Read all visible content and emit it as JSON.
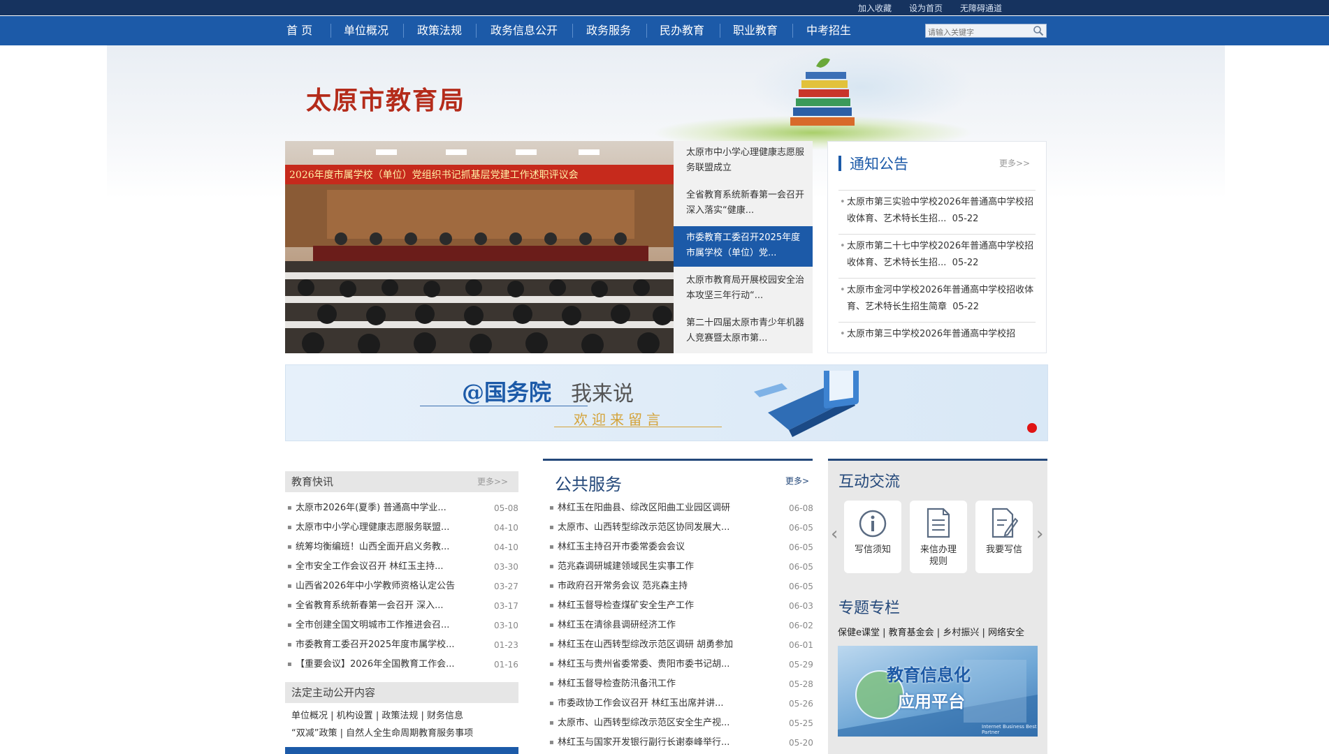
{
  "topbar": {
    "links": [
      "加入收藏",
      "设为首页",
      "无障碍通道"
    ]
  },
  "nav": {
    "items": [
      "首 页",
      "单位概况",
      "政策法规",
      "政务信息公开",
      "政务服务",
      "民办教育",
      "职业教育",
      "中考招生"
    ],
    "search_placeholder": "请输入关键字"
  },
  "banner": {
    "site_title": "太原市教育局"
  },
  "slider": {
    "photo_caption": "2026年度市属学校（单位）党组织书记抓基层党建工作述职评议会",
    "tabs": [
      "太原市中小学心理健康志愿服务联盟成立",
      "全省教育系统新春第一会召开 深入落实“健康...",
      "市委教育工委召开2025年度市属学校（单位）党...",
      "太原市教育局开展校园安全治本攻坚三年行动“...",
      "第二十四届太原市青少年机器人竞赛暨太原市第..."
    ],
    "active_index": 2
  },
  "notice": {
    "title": "通知公告",
    "more": "更多>>",
    "items": [
      {
        "text": "太原市第三实验中学校2026年普通高中学校招收体育、艺术特长生招...",
        "date": "05-22"
      },
      {
        "text": "太原市第二十七中学校2026年普通高中学校招收体育、艺术特长生招...",
        "date": "05-22"
      },
      {
        "text": "太原市金河中学校2026年普通高中学校招收体育、艺术特长生招生简章",
        "date": "05-22"
      },
      {
        "text": "太原市第三中学校2026年普通高中学校招",
        "date": ""
      }
    ]
  },
  "promo": {
    "line1a": "@国务院",
    "line1b": "我来说",
    "line2": "欢迎来留言"
  },
  "edu_news": {
    "title": "教育快讯",
    "more": "更多>>",
    "items": [
      {
        "text": "太原市2026年(夏季) 普通高中学业...",
        "date": "05-08"
      },
      {
        "text": "太原市中小学心理健康志愿服务联盟...",
        "date": "04-10"
      },
      {
        "text": "统筹均衡编班！山西全面开启义务教...",
        "date": "04-10"
      },
      {
        "text": "全市安全工作会议召开 林红玉主持...",
        "date": "03-30"
      },
      {
        "text": "山西省2026年中小学教师资格认定公告",
        "date": "03-27"
      },
      {
        "text": "全省教育系统新春第一会召开 深入...",
        "date": "03-17"
      },
      {
        "text": "全市创建全国文明城市工作推进会召...",
        "date": "03-10"
      },
      {
        "text": "市委教育工委召开2025年度市属学校...",
        "date": "01-23"
      },
      {
        "text": "【重要会议】2026年全国教育工作会...",
        "date": "01-16"
      }
    ]
  },
  "legal": {
    "title": "法定主动公开内容",
    "row1": [
      "单位概况",
      "机构设置",
      "政策法规",
      "财务信息"
    ],
    "row2": [
      "“双减”政策",
      "自然人全生命周期教育服务事项"
    ]
  },
  "public_service": {
    "title": "公共服务",
    "more": "更多>",
    "items": [
      {
        "text": "林红玉在阳曲县、综改区阳曲工业园区调研",
        "date": "06-08"
      },
      {
        "text": "太原市、山西转型综改示范区协同发展大...",
        "date": "06-05"
      },
      {
        "text": "林红玉主持召开市委常委会会议",
        "date": "06-05"
      },
      {
        "text": "范兆森调研城建领域民生实事工作",
        "date": "06-05"
      },
      {
        "text": "市政府召开常务会议 范兆森主持",
        "date": "06-05"
      },
      {
        "text": "林红玉督导检查煤矿安全生产工作",
        "date": "06-03"
      },
      {
        "text": "林红玉在清徐县调研经济工作",
        "date": "06-02"
      },
      {
        "text": "林红玉在山西转型综改示范区调研 胡勇参加",
        "date": "06-01"
      },
      {
        "text": "林红玉与贵州省委常委、贵阳市委书记胡...",
        "date": "05-29"
      },
      {
        "text": "林红玉督导检查防汛备汛工作",
        "date": "05-28"
      },
      {
        "text": "市委政协工作会议召开 林红玉出席并讲...",
        "date": "05-26"
      },
      {
        "text": "太原市、山西转型综改示范区安全生产视...",
        "date": "05-25"
      },
      {
        "text": "林红玉与国家开发银行副行长谢泰峰举行...",
        "date": "05-20"
      }
    ]
  },
  "interact": {
    "title": "互动交流",
    "cards": [
      "写信须知",
      "来信办理规则",
      "我要写信"
    ],
    "topics_title": "专题专栏",
    "topics": [
      "保健e课堂",
      "教育基金会",
      "乡村振兴",
      "网络安全"
    ],
    "platform_line1": "教育信息化",
    "platform_line2": "应用平台",
    "platform_small": "Internet Business Best Partner"
  },
  "colors": {
    "topbar": "#16335f",
    "nav": "#1c5aa8",
    "title_red": "#b42b1a",
    "accent_blue": "#1c5aa8"
  }
}
